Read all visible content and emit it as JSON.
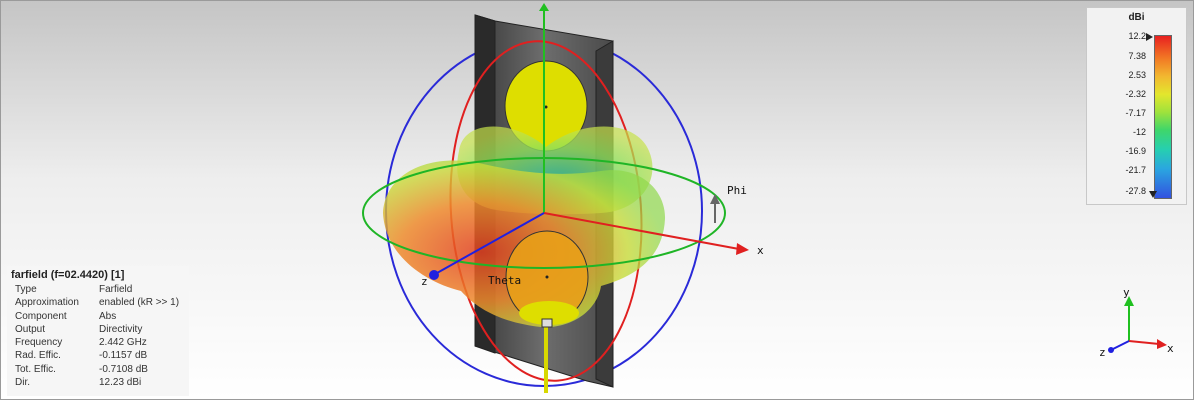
{
  "info": {
    "title": "farfield (f=02.4420) [1]",
    "rows": [
      {
        "key": "Type",
        "value": "Farfield"
      },
      {
        "key": "Approximation",
        "value": "enabled (kR >> 1)"
      },
      {
        "key": "Component",
        "value": "Abs"
      },
      {
        "key": "Output",
        "value": "Directivity"
      },
      {
        "key": "Frequency",
        "value": "2.442 GHz"
      },
      {
        "key": "Rad. Effic.",
        "value": "-0.1157 dB"
      },
      {
        "key": "Tot. Effic.",
        "value": "-0.7108 dB"
      },
      {
        "key": "Dir.",
        "value": "12.23 dBi"
      }
    ]
  },
  "legend": {
    "unit": "dBi",
    "ticks": [
      "12.2",
      "7.38",
      "2.53",
      "-2.32",
      "-7.17",
      "-12",
      "-16.9",
      "-21.7",
      "-27.8"
    ],
    "max_color": "#e82020",
    "min_color": "#3252e0"
  },
  "scene": {
    "axis_labels": {
      "x": "x",
      "z": "z",
      "phi": "Phi",
      "theta": "Theta"
    },
    "colors": {
      "phi_circle": "#1fb526",
      "theta_circle_red": "#e02020",
      "theta_circle_blue": "#2a2ad8",
      "x_axis": "#e02020",
      "y_axis": "#20c020",
      "z_axis": "#2020e0",
      "patch": "#dede00",
      "plate": "#555555"
    }
  },
  "triad": {
    "x": "x",
    "y": "y",
    "z": "z"
  }
}
